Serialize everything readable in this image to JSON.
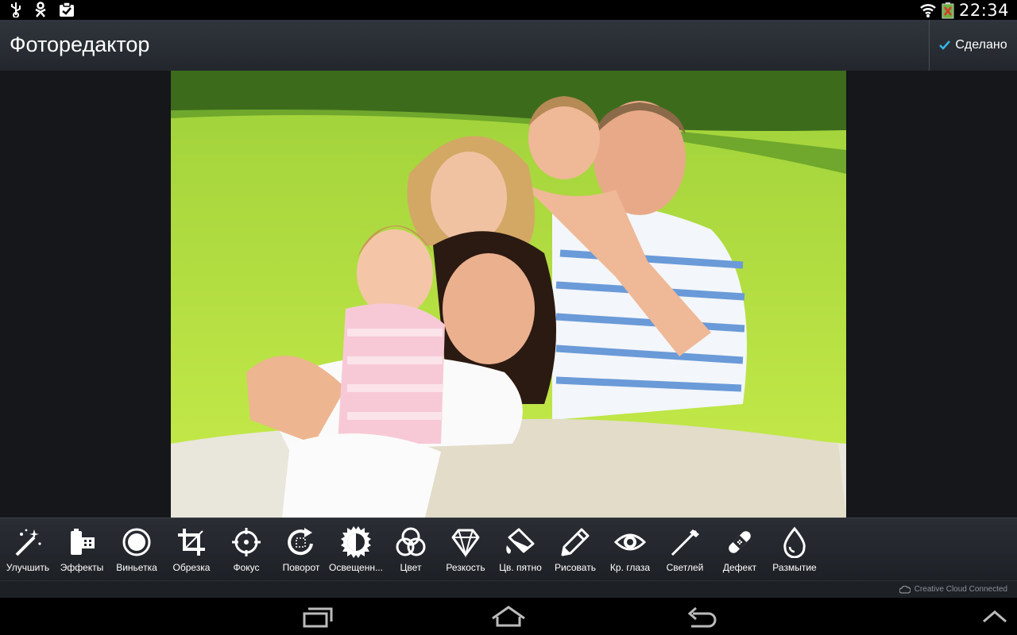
{
  "status": {
    "time": "22:34",
    "icons": [
      "usb-icon",
      "odnoklassniki-icon",
      "clipboard-check-icon",
      "wifi-icon",
      "battery-icon"
    ]
  },
  "header": {
    "title": "Фоторедактор",
    "done_label": "Сделано"
  },
  "colors": {
    "accent": "#33b5e5",
    "action_bar": "#2b3036",
    "toolbar": "#24282d"
  },
  "toolbar": {
    "tools": [
      {
        "label": "Улучшить",
        "icon": "magic-wand-icon"
      },
      {
        "label": "Эффекты",
        "icon": "film-icon"
      },
      {
        "label": "Виньетка",
        "icon": "vignette-icon"
      },
      {
        "label": "Обрезка",
        "icon": "crop-icon"
      },
      {
        "label": "Фокус",
        "icon": "focus-icon"
      },
      {
        "label": "Поворот",
        "icon": "rotate-icon"
      },
      {
        "label": "Освещенн...",
        "icon": "brightness-icon"
      },
      {
        "label": "Цвет",
        "icon": "color-icon"
      },
      {
        "label": "Резкость",
        "icon": "diamond-icon"
      },
      {
        "label": "Цв. пятно",
        "icon": "paint-bucket-icon"
      },
      {
        "label": "Рисовать",
        "icon": "pencil-icon"
      },
      {
        "label": "Кр. глаза",
        "icon": "eye-icon"
      },
      {
        "label": "Светлей",
        "icon": "whiten-brush-icon"
      },
      {
        "label": "Дефект",
        "icon": "bandage-icon"
      },
      {
        "label": "Размытие",
        "icon": "drop-icon"
      }
    ]
  },
  "footer": {
    "cc_text": "Creative Cloud Connected"
  },
  "navigation": {
    "buttons": [
      "recent-apps-icon",
      "home-icon",
      "back-icon",
      "menu-up-icon"
    ]
  }
}
